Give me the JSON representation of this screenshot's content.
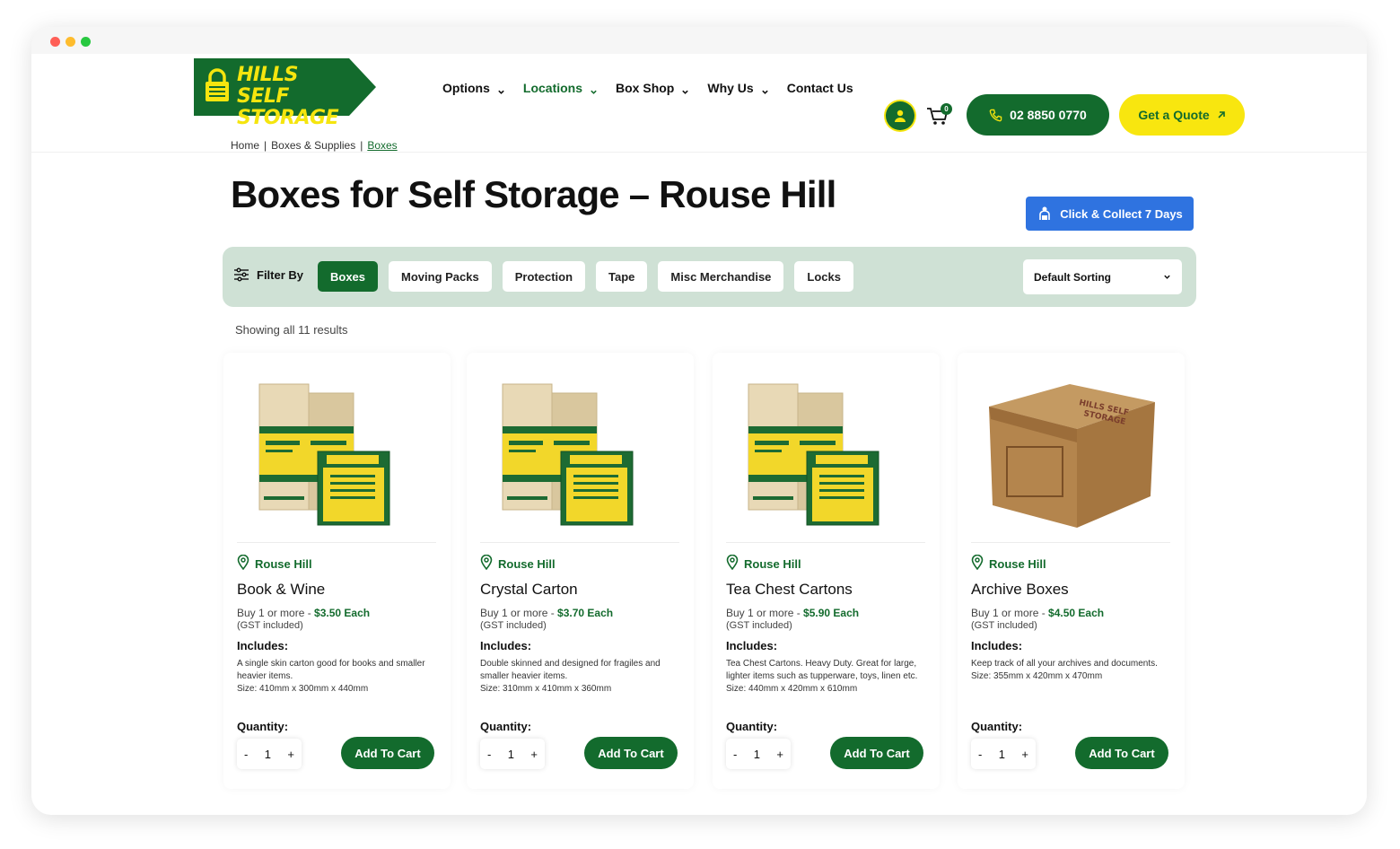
{
  "brand": {
    "logo_text": "HILLS SELF STORAGE",
    "primary_color": "#136b2d",
    "accent_color": "#f5e50e",
    "blue_color": "#2f73e0"
  },
  "nav": {
    "items": [
      {
        "label": "Options",
        "has_dropdown": true,
        "active": false
      },
      {
        "label": "Locations",
        "has_dropdown": true,
        "active": true
      },
      {
        "label": "Box Shop",
        "has_dropdown": true,
        "active": false
      },
      {
        "label": "Why Us",
        "has_dropdown": true,
        "active": false
      },
      {
        "label": "Contact Us",
        "has_dropdown": false,
        "active": false
      }
    ],
    "account_icon": "user-icon",
    "cart_icon": "cart-icon",
    "cart_count": "0",
    "phone_label": "02 8850 0770",
    "quote_label": "Get a Quote"
  },
  "breadcrumb": {
    "items": [
      "Home",
      "Boxes & Supplies",
      "Boxes"
    ],
    "separator": "|"
  },
  "page": {
    "title": "Boxes for Self Storage – Rouse Hill",
    "collect_label": "Click & Collect 7 Days",
    "results_count": "Showing all 11 results"
  },
  "filter": {
    "label": "Filter By",
    "chips": [
      {
        "label": "Boxes",
        "active": true
      },
      {
        "label": "Moving Packs",
        "active": false
      },
      {
        "label": "Protection",
        "active": false
      },
      {
        "label": "Tape",
        "active": false
      },
      {
        "label": "Misc Merchandise",
        "active": false
      },
      {
        "label": "Locks",
        "active": false
      }
    ],
    "sort_selected": "Default Sorting"
  },
  "products": [
    {
      "location": "Rouse Hill",
      "title": "Book & Wine",
      "price_prefix": "Buy 1 or more  -",
      "price": "$3.50 Each",
      "gst": "(GST included)",
      "includes_label": "Includes:",
      "description": "A single skin carton good for books and smaller heavier items.",
      "size": "Size: 410mm x 300mm x 440mm",
      "quantity_label": "Quantity:",
      "quantity": "1",
      "add_label": "Add To Cart",
      "image_type": "branded-boxes"
    },
    {
      "location": "Rouse Hill",
      "title": "Crystal Carton",
      "price_prefix": "Buy 1 or more  -",
      "price": "$3.70 Each",
      "gst": "(GST included)",
      "includes_label": "Includes:",
      "description": "Double skinned and designed for fragiles and smaller heavier items.",
      "size": "Size: 310mm x 410mm x 360mm",
      "quantity_label": "Quantity:",
      "quantity": "1",
      "add_label": "Add To Cart",
      "image_type": "branded-boxes"
    },
    {
      "location": "Rouse Hill",
      "title": "Tea Chest Cartons",
      "price_prefix": "Buy 1 or more  -",
      "price": "$5.90 Each",
      "gst": "(GST included)",
      "includes_label": "Includes:",
      "description": "Tea Chest Cartons. Heavy Duty. Great for large, lighter items such as tupperware, toys, linen etc.",
      "size": "Size: 440mm x 420mm x 610mm",
      "quantity_label": "Quantity:",
      "quantity": "1",
      "add_label": "Add To Cart",
      "image_type": "branded-boxes"
    },
    {
      "location": "Rouse Hill",
      "title": "Archive Boxes",
      "price_prefix": "Buy 1 or more  -",
      "price": "$4.50 Each",
      "gst": "(GST included)",
      "includes_label": "Includes:",
      "description": "Keep track of all your archives and documents.",
      "size": "Size: 355mm x 420mm x 470mm",
      "quantity_label": "Quantity:",
      "quantity": "1",
      "add_label": "Add To Cart",
      "image_type": "archive-box"
    }
  ]
}
